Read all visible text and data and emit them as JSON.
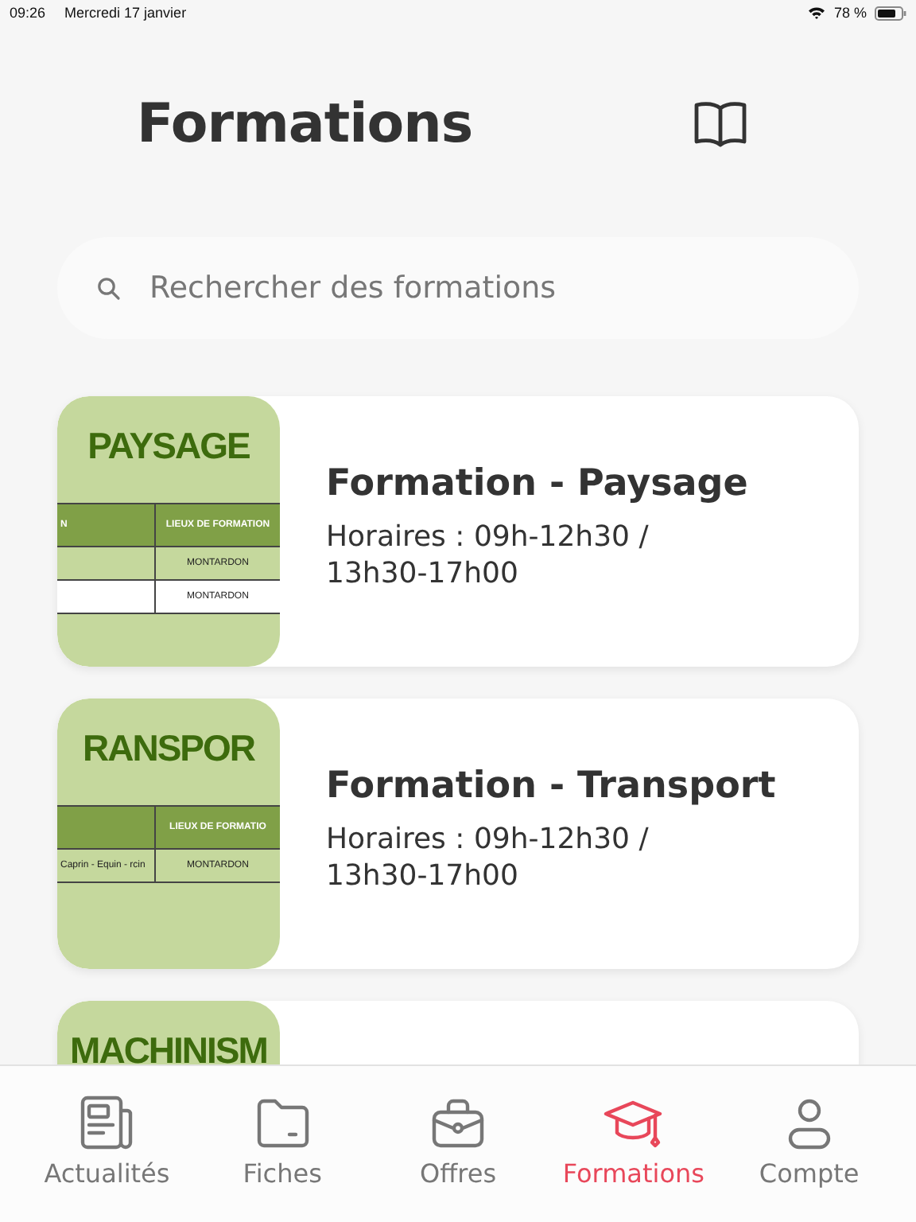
{
  "status_bar": {
    "time": "09:26",
    "date": "Mercredi 17 janvier",
    "battery": "78 %"
  },
  "header": {
    "title": "Formations"
  },
  "search": {
    "placeholder": "Rechercher des formations"
  },
  "formations": [
    {
      "title": "Formation - Paysage",
      "schedule": "Horaires : 09h-12h30 / 13h30-17h00",
      "thumbnail": {
        "heading": "PAYSAGE",
        "rows": [
          [
            "N",
            "LIEUX DE FORMATION"
          ],
          [
            null,
            "MONTARDON"
          ],
          [
            null,
            "MONTARDON"
          ]
        ]
      }
    },
    {
      "title": "Formation - Transport",
      "schedule": "Horaires : 09h-12h30 / 13h30-17h00",
      "thumbnail": {
        "heading": "RANSPOR",
        "rows": [
          [
            null,
            "LIEUX DE FORMATIO"
          ],
          [
            "Caprin - Equin - rcin",
            "MONTARDON"
          ]
        ]
      }
    },
    {
      "thumbnail": {
        "heading": "MACHINISM"
      }
    }
  ],
  "tabs": [
    {
      "kind": "news",
      "label": "Actualités",
      "selected": false
    },
    {
      "kind": "folder",
      "label": "Fiches",
      "selected": false
    },
    {
      "kind": "briefcase",
      "label": "Offres",
      "selected": false
    },
    {
      "kind": "cap",
      "label": "Formations",
      "selected": true
    },
    {
      "kind": "person",
      "label": "Compte",
      "selected": false
    }
  ]
}
